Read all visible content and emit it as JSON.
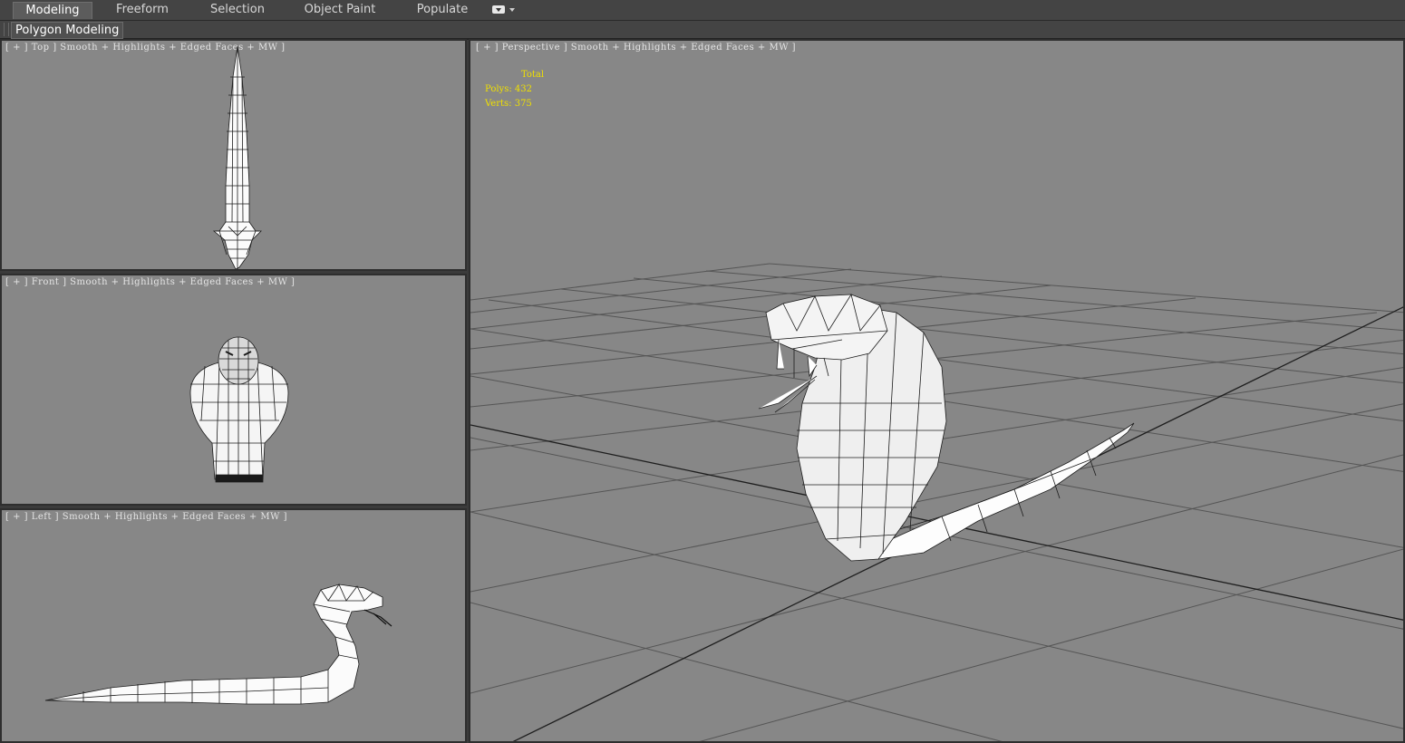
{
  "ribbon": {
    "tabs": [
      {
        "label": "Modeling",
        "active": true
      },
      {
        "label": "Freeform",
        "active": false
      },
      {
        "label": "Selection",
        "active": false
      },
      {
        "label": "Object Paint",
        "active": false
      },
      {
        "label": "Populate",
        "active": false
      }
    ],
    "sub_panel": "Polygon Modeling"
  },
  "viewports": {
    "top": {
      "label": "[ + ] Top ] Smooth + Highlights + Edged Faces + MW ]"
    },
    "front": {
      "label": "[ + ] Front ] Smooth + Highlights + Edged Faces + MW ]"
    },
    "left": {
      "label": "[ + ] Left ] Smooth + Highlights + Edged Faces + MW ]"
    },
    "perspective": {
      "label": "[ + ] Perspective ] Smooth + Highlights + Edged Faces + MW ]"
    }
  },
  "stats": {
    "header": "Total",
    "polys": "Polys: 432",
    "verts": "Verts: 375"
  },
  "colors": {
    "viewport_bg": "#878787",
    "stats_text": "#f0e000",
    "active_border": "#2e2e2e"
  }
}
